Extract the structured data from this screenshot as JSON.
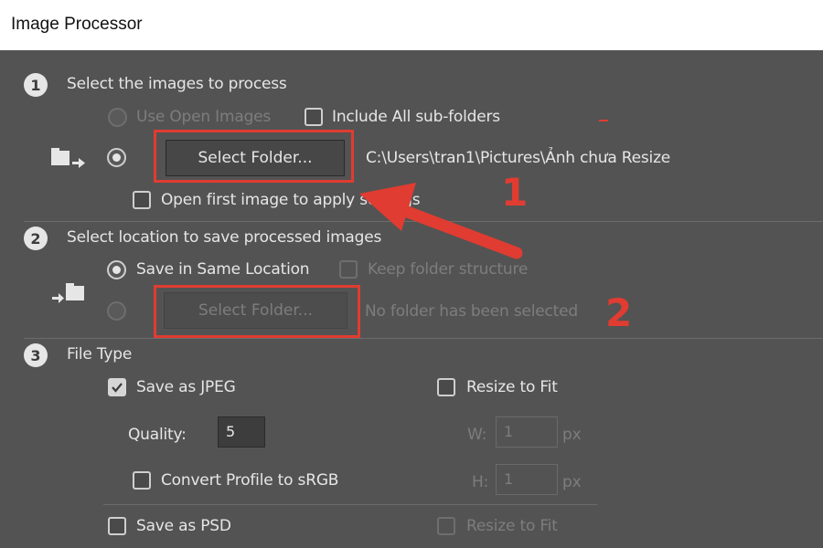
{
  "window": {
    "title": "Image Processor"
  },
  "section1": {
    "step": "1",
    "heading": "Select the images to process",
    "use_open_images": "Use Open Images",
    "include_subfolders": "Include All sub-folders",
    "select_folder": "Select Folder...",
    "folder_path": "C:\\Users\\tran1\\Pictures\\Ảnh chưa Resize",
    "open_first_image": "Open first image to apply settings"
  },
  "section2": {
    "step": "2",
    "heading": "Select location to save processed images",
    "save_same_location": "Save in Same Location",
    "keep_folder_structure": "Keep folder structure",
    "select_folder": "Select Folder...",
    "no_folder": "No folder has been selected"
  },
  "section3": {
    "step": "3",
    "heading": "File Type",
    "save_as_jpeg": "Save as JPEG",
    "resize_to_fit": "Resize to Fit",
    "quality_label": "Quality:",
    "quality_value": "5",
    "w_label": "W:",
    "w_value": "1",
    "h_label": "H:",
    "h_value": "1",
    "px": "px",
    "convert_profile": "Convert Profile to sRGB",
    "save_as_psd": "Save as PSD",
    "resize_to_fit_psd": "Resize to Fit"
  },
  "annotations": {
    "label1": "1",
    "label2": "2"
  },
  "colors": {
    "annotation": "#e03c31",
    "dialog_bg": "#535353"
  },
  "icons": [
    "folder-arrow-icon",
    "save-location-icon",
    "checkmark-icon"
  ]
}
